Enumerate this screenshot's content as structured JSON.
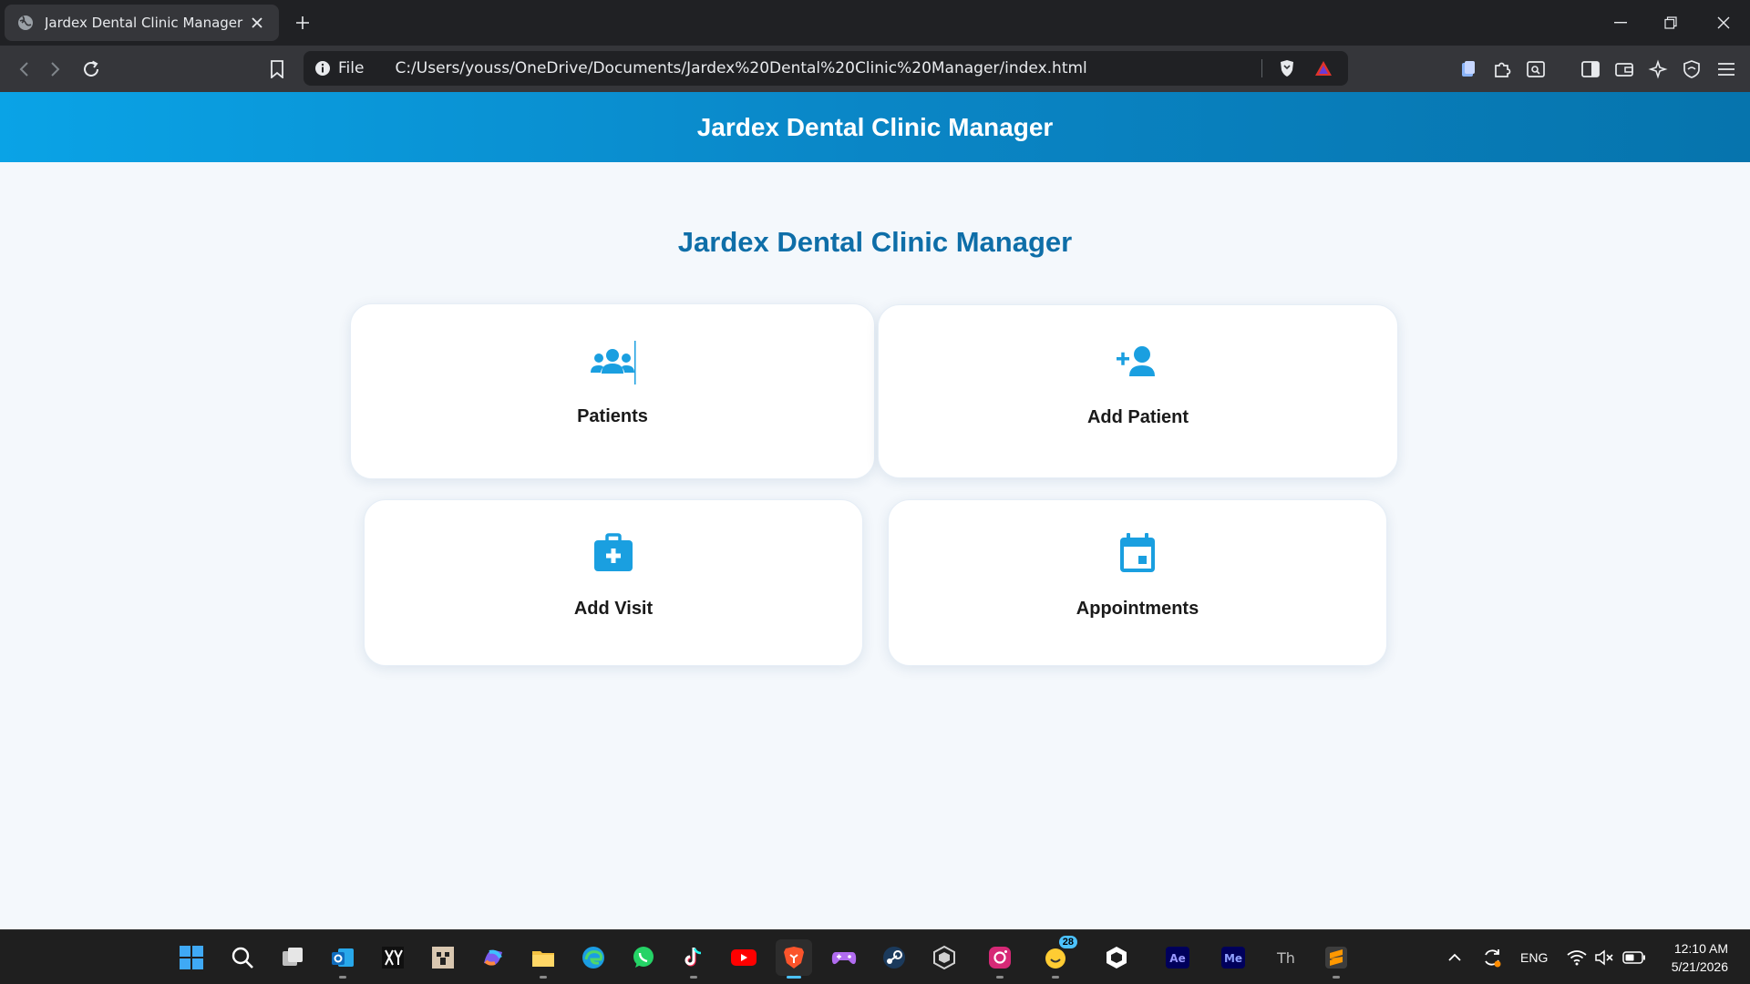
{
  "browser": {
    "tab_title": "Jardex Dental Clinic Manager",
    "address_scheme": "File",
    "address_url": "C:/Users/youss/OneDrive/Documents/Jardex%20Dental%20Clinic%20Manager/index.html"
  },
  "page": {
    "header_title": "Jardex Dental Clinic Manager",
    "main_title": "Jardex Dental Clinic Manager",
    "cards": [
      {
        "label": "Patients",
        "icon": "users-icon"
      },
      {
        "label": "Add Patient",
        "icon": "user-plus-icon"
      },
      {
        "label": "Add Visit",
        "icon": "medical-kit-icon"
      },
      {
        "label": "Appointments",
        "icon": "calendar-icon"
      }
    ]
  },
  "taskbar": {
    "language": "ENG",
    "notification_badge": "28",
    "time": "12:10 AM",
    "date": "5/21/2026"
  },
  "colors": {
    "accent": "#1a9fe0",
    "title_blue": "#0e6ea8",
    "header_start": "#0aa3e6",
    "header_end": "#0674ad"
  }
}
